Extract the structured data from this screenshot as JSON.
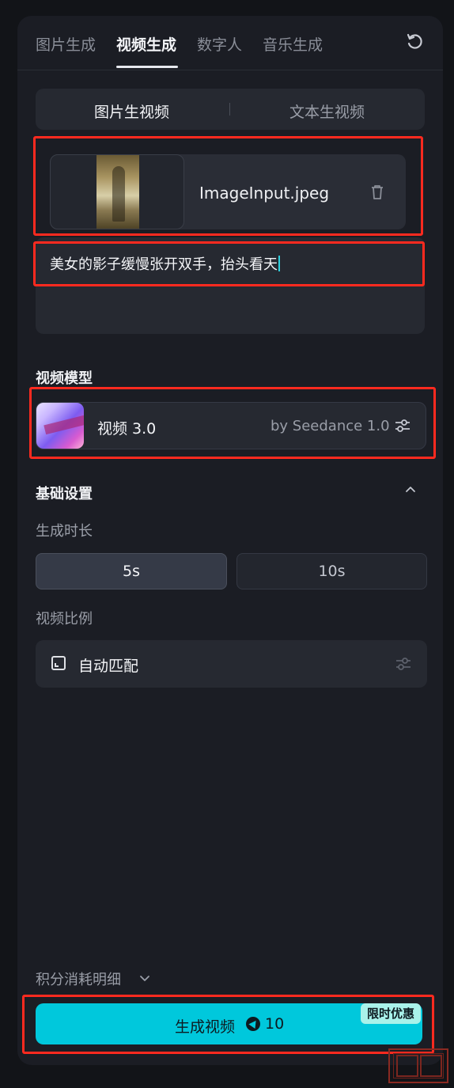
{
  "tabs": [
    {
      "label": "图片生成",
      "active": false
    },
    {
      "label": "视频生成",
      "active": true
    },
    {
      "label": "数字人",
      "active": false
    },
    {
      "label": "音乐生成",
      "active": false
    }
  ],
  "mode": {
    "image_to_video": "图片生视频",
    "text_to_video": "文本生视频",
    "selected": "image_to_video"
  },
  "upload": {
    "filename": "ImageInput.jpeg"
  },
  "prompt": {
    "value": "美女的影子缓慢张开双手，抬头看天"
  },
  "model_section": {
    "heading": "视频模型",
    "model_name": "视频 3.0",
    "provider": "by Seedance 1.0"
  },
  "basic_settings": {
    "heading": "基础设置",
    "expanded": true,
    "duration_label": "生成时长",
    "durations": [
      "5s",
      "10s"
    ],
    "selected_duration": "5s",
    "ratio_label": "视频比例",
    "ratio_value": "自动匹配"
  },
  "footer": {
    "credits_label": "积分消耗明细",
    "generate_label": "生成视频",
    "cost": "10",
    "promo_badge": "限时优惠"
  },
  "colors": {
    "accent": "#00c8dc",
    "highlight_box": "#ff2a1f",
    "panel_bg": "#1b1d24"
  },
  "icons": {
    "refresh": "refresh-icon",
    "trash": "trash-icon",
    "settings": "sliders-icon",
    "collapse": "chevron-up-icon",
    "expand": "chevron-down-icon",
    "aspect_ratio": "aspect-ratio-icon",
    "credit": "credit-coin-icon"
  }
}
